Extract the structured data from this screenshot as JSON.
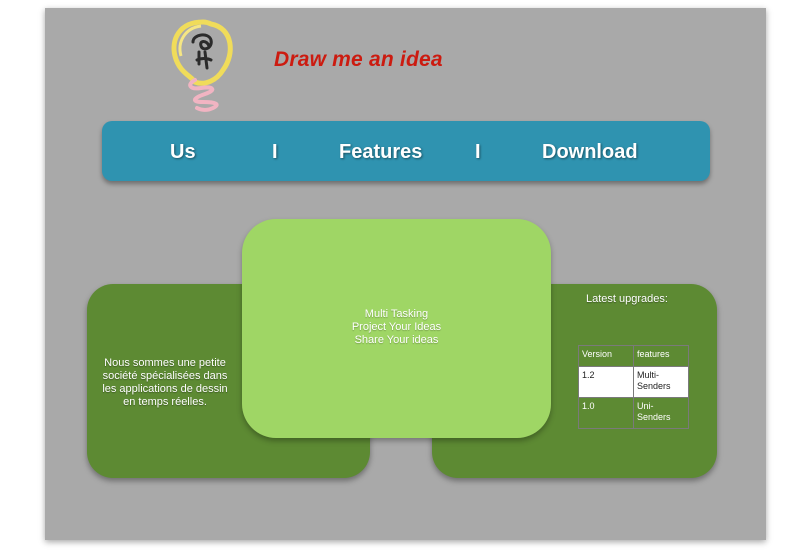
{
  "header": {
    "title": "Draw me an idea",
    "title_color": "#cc1b10",
    "logo_icon": "lightbulb-sketch-icon"
  },
  "nav": {
    "items": [
      "Us",
      "Features",
      "Download"
    ],
    "separator": "I",
    "color": "#2f93b0"
  },
  "left_panel": {
    "text": "Nous sommes une petite société spécialisées dans les applications de dessin en temps réelles."
  },
  "center_panel": {
    "features": [
      "Multi Tasking",
      "Project Your Ideas",
      "Share Your ideas"
    ]
  },
  "right_panel": {
    "title": "Latest upgrades:",
    "table": {
      "headers": [
        "Version",
        "features"
      ],
      "rows": [
        [
          "1.2",
          "Multi-Senders"
        ],
        [
          "1.0",
          "Uni-Senders"
        ]
      ]
    }
  },
  "colors": {
    "background": "#a9a9a9",
    "panel_dark_green": "#5d8a33",
    "panel_light_green": "#9fd665"
  }
}
